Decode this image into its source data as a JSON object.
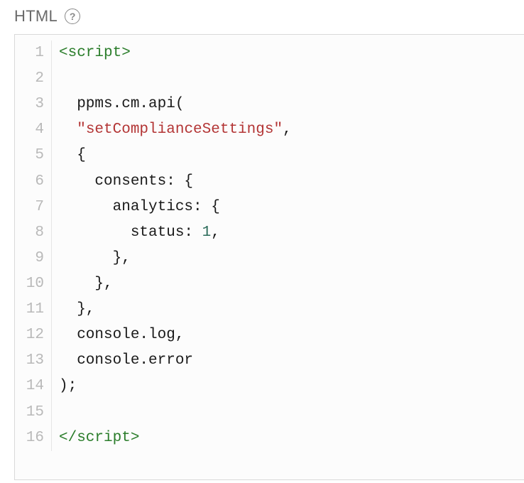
{
  "header": {
    "label": "HTML",
    "help_tooltip": "?"
  },
  "code": {
    "line_numbers": [
      "1",
      "2",
      "3",
      "4",
      "5",
      "6",
      "7",
      "8",
      "9",
      "10",
      "11",
      "12",
      "13",
      "14",
      "15",
      "16"
    ],
    "lines": [
      [
        {
          "c": "tag",
          "t": "<script>"
        }
      ],
      [
        {
          "c": "pln",
          "t": ""
        }
      ],
      [
        {
          "c": "pln",
          "t": "  ppms.cm.api("
        }
      ],
      [
        {
          "c": "pln",
          "t": "  "
        },
        {
          "c": "str",
          "t": "\"setComplianceSettings\""
        },
        {
          "c": "pln",
          "t": ","
        }
      ],
      [
        {
          "c": "pln",
          "t": "  {"
        }
      ],
      [
        {
          "c": "pln",
          "t": "    consents: {"
        }
      ],
      [
        {
          "c": "pln",
          "t": "      analytics: {"
        }
      ],
      [
        {
          "c": "pln",
          "t": "        status: "
        },
        {
          "c": "num",
          "t": "1"
        },
        {
          "c": "pln",
          "t": ","
        }
      ],
      [
        {
          "c": "pln",
          "t": "      },"
        }
      ],
      [
        {
          "c": "pln",
          "t": "    },"
        }
      ],
      [
        {
          "c": "pln",
          "t": "  },"
        }
      ],
      [
        {
          "c": "pln",
          "t": "  console.log,"
        }
      ],
      [
        {
          "c": "pln",
          "t": "  console.error"
        }
      ],
      [
        {
          "c": "pln",
          "t": ");"
        }
      ],
      [
        {
          "c": "pln",
          "t": ""
        }
      ],
      [
        {
          "c": "tag",
          "t": "</scr"
        },
        {
          "c": "tag",
          "t": "ipt>"
        }
      ]
    ]
  }
}
